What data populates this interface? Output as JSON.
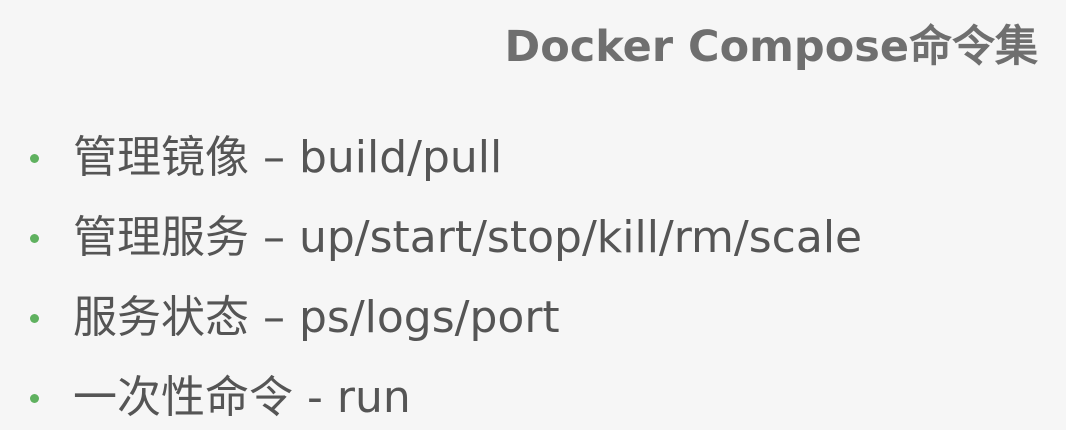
{
  "title": "Docker Compose命令集",
  "accent_color": "#5fb15f",
  "bullets": [
    {
      "text": "管理镜像 – build/pull"
    },
    {
      "text": "管理服务 – up/start/stop/kill/rm/scale"
    },
    {
      "text": "服务状态 – ps/logs/port"
    },
    {
      "text": "一次性命令 - run"
    }
  ]
}
